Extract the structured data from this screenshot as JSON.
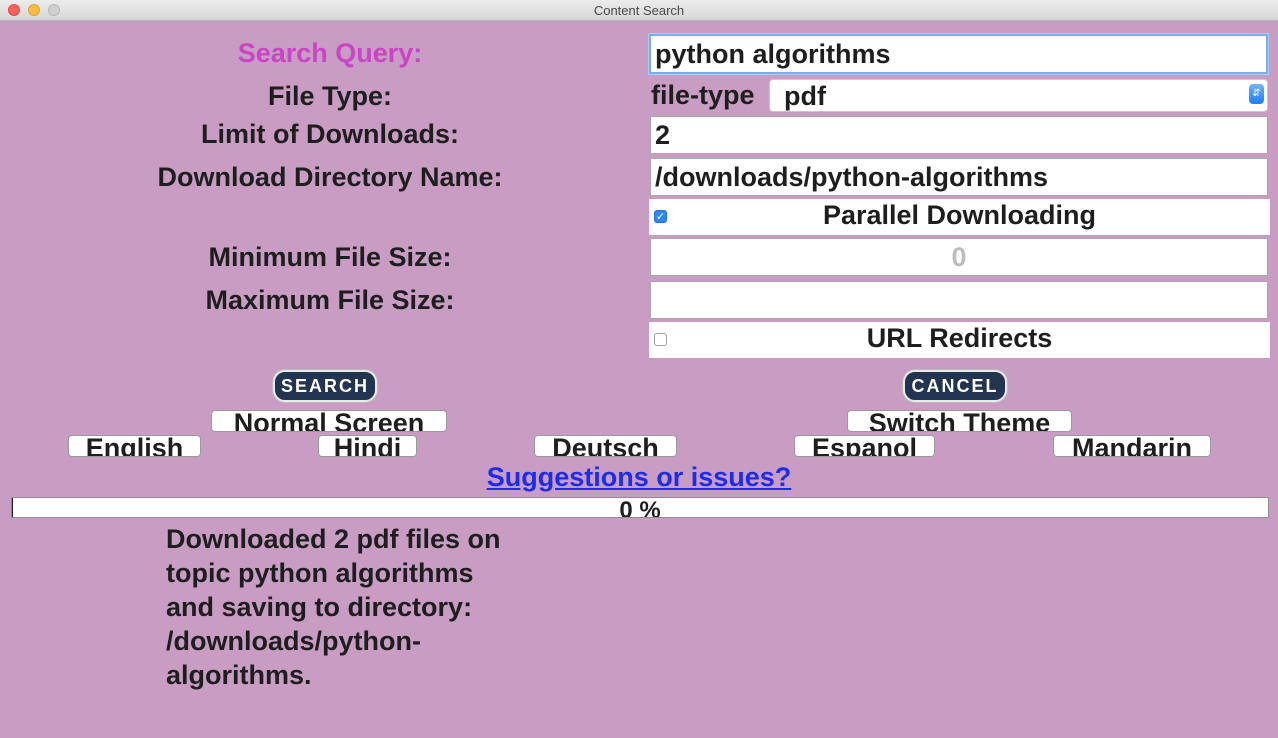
{
  "window": {
    "title": "Content Search"
  },
  "form": {
    "search_query_label": "Search Query:",
    "search_query_value": "python algorithms",
    "file_type_label": "File Type:",
    "file_type_prefix": "file-type",
    "file_type_selected": "pdf",
    "limit_label": "Limit of Downloads:",
    "limit_value": "2",
    "dir_label": "Download Directory Name:",
    "dir_value": "/downloads/python-algorithms",
    "parallel_label": "Parallel Downloading",
    "parallel_checked": true,
    "min_size_label": "Minimum File Size:",
    "min_size_placeholder": "0",
    "max_size_label": "Maximum File Size:",
    "max_size_value": "",
    "redirects_label": "URL Redirects",
    "redirects_checked": false
  },
  "actions": {
    "search_label": "SEARCH",
    "cancel_label": "CANCEL",
    "normal_screen_label": "Normal Screen",
    "switch_theme_label": "Switch Theme"
  },
  "languages": [
    "English",
    "Hindi",
    "Deutsch",
    "Espanol",
    "Mandarin"
  ],
  "feedback_link": "Suggestions or issues?",
  "progress": {
    "percent": 0,
    "text": "0 %"
  },
  "status_message": "Downloaded 2 pdf files on topic python algorithms and saving to directory: /downloads/python-algorithms.",
  "colors": {
    "background": "#c99cc4",
    "query_label": "#c944c6",
    "link": "#1b2bf0",
    "pill": "#22344f"
  }
}
